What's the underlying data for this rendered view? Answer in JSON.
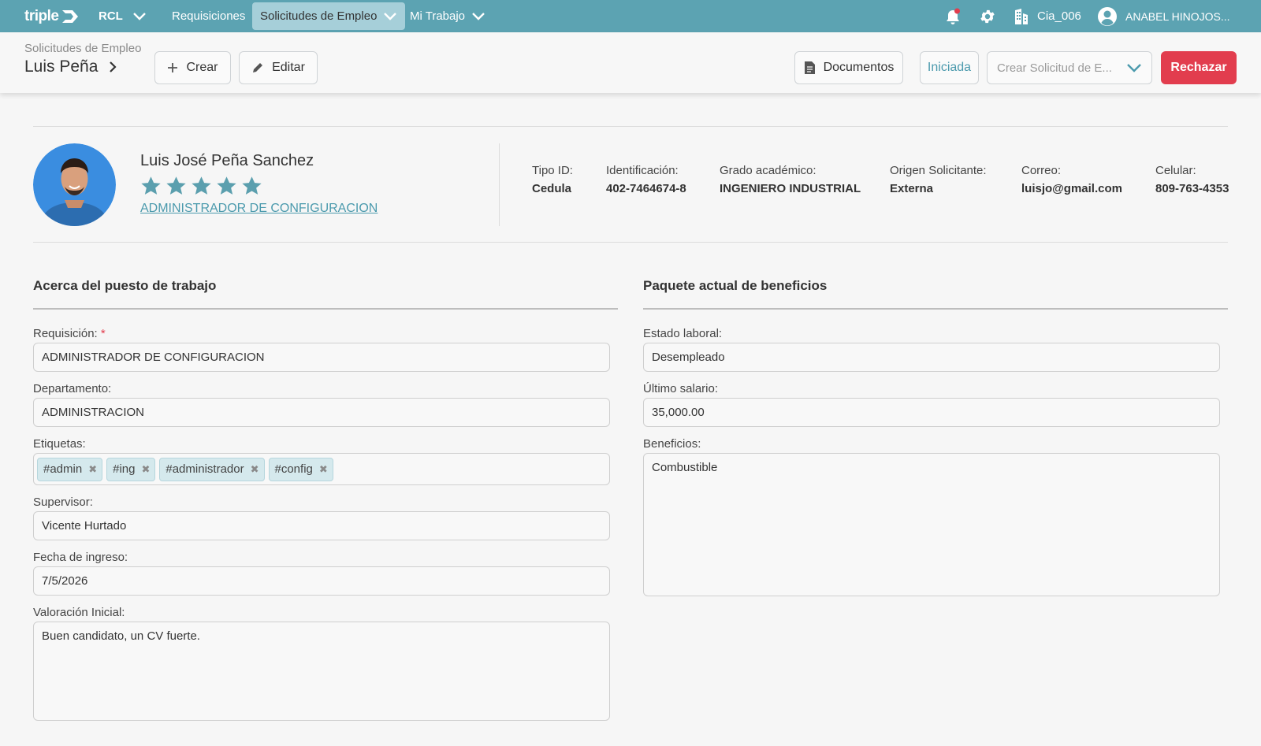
{
  "topnav": {
    "logo": "triple",
    "company": "RCL",
    "items": [
      {
        "label": "Requisiciones"
      },
      {
        "label": "Solicitudes de Empleo"
      },
      {
        "label": "Mi Trabajo"
      }
    ],
    "cia": "Cia_006",
    "user": "ANABEL HINOJOS..."
  },
  "header": {
    "breadcrumb": "Solicitudes de Empleo",
    "title": "Luis Peña",
    "create_label": "Crear",
    "edit_label": "Editar",
    "documents_label": "Documentos",
    "status_label": "Iniciada",
    "dropdown_placeholder": "Crear Solicitud de E...",
    "reject_label": "Rechazar"
  },
  "profile": {
    "name": "Luis José Peña Sanchez",
    "rating": 5,
    "position_link": "ADMINISTRADOR DE CONFIGURACION",
    "info": [
      {
        "label": "Tipo ID:",
        "value": "Cedula"
      },
      {
        "label": "Identificación:",
        "value": "402-7464674-8"
      },
      {
        "label": "Grado académico:",
        "value": "INGENIERO INDUSTRIAL"
      },
      {
        "label": "Origen Solicitante:",
        "value": "Externa"
      },
      {
        "label": "Correo:",
        "value": "luisjo@gmail.com"
      },
      {
        "label": "Celular:",
        "value": "809-763-4353"
      }
    ]
  },
  "job": {
    "title": "Acerca del puesto de trabajo",
    "requisition_label": "Requisición:",
    "requisition_required": "*",
    "requisition": "ADMINISTRADOR DE CONFIGURACION",
    "department_label": "Departamento:",
    "department": "ADMINISTRACION",
    "tags_label": "Etiquetas:",
    "tags": [
      "#admin",
      "#ing",
      "#administrador",
      "#config"
    ],
    "supervisor_label": "Supervisor:",
    "supervisor": "Vicente Hurtado",
    "start_date_label": "Fecha de ingreso:",
    "start_date": "7/5/2026",
    "assessment_label": "Valoración Inicial:",
    "assessment": "Buen candidato, un CV fuerte."
  },
  "benefits": {
    "title": "Paquete actual de beneficios",
    "employment_status_label": "Estado laboral:",
    "employment_status": "Desempleado",
    "last_salary_label": "Último salario:",
    "last_salary": "35,000.00",
    "benefits_label": "Beneficios:",
    "benefits": "Combustible"
  },
  "colors": {
    "nav": "#5ca3b2",
    "accent": "#4b9aad",
    "star": "#5b9fae",
    "reject": "#e23d4e",
    "tag_bg": "#d5e9ed"
  }
}
